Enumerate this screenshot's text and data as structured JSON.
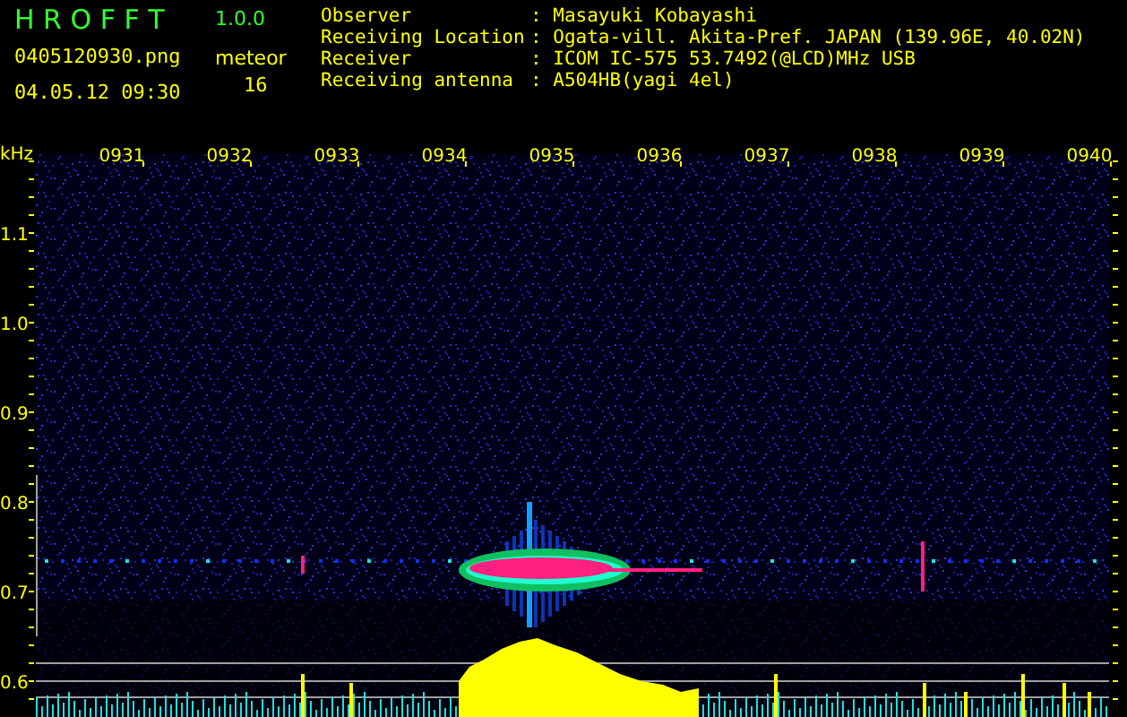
{
  "app": {
    "title": "H R O F F T",
    "version": "1.0.0",
    "filename": "0405120930.png",
    "datetime": "04.05.12 09:30",
    "meteor_label": "meteor",
    "meteor_count": "16"
  },
  "info": [
    {
      "label": "Observer",
      "value": ": Masayuki Kobayashi"
    },
    {
      "label": "Receiving Location",
      "value": ": Ogata-vill. Akita-Pref. JAPAN (139.96E, 40.02N)"
    },
    {
      "label": "Receiver",
      "value": ": ICOM IC-575 53.7492(@LCD)MHz USB"
    },
    {
      "label": "Receiving antenna",
      "value": ": A504HB(yagi 4el)"
    }
  ],
  "spectrogram": {
    "unit": "kHz",
    "frequency_labels": [
      "1.1",
      "1.0",
      "0.9",
      "0.8",
      "0.7",
      "0.6"
    ],
    "time_labels": [
      "0931",
      "0932",
      "0933",
      "0934",
      "0935",
      "0936",
      "0937",
      "0938",
      "0939",
      "0940"
    ]
  }
}
